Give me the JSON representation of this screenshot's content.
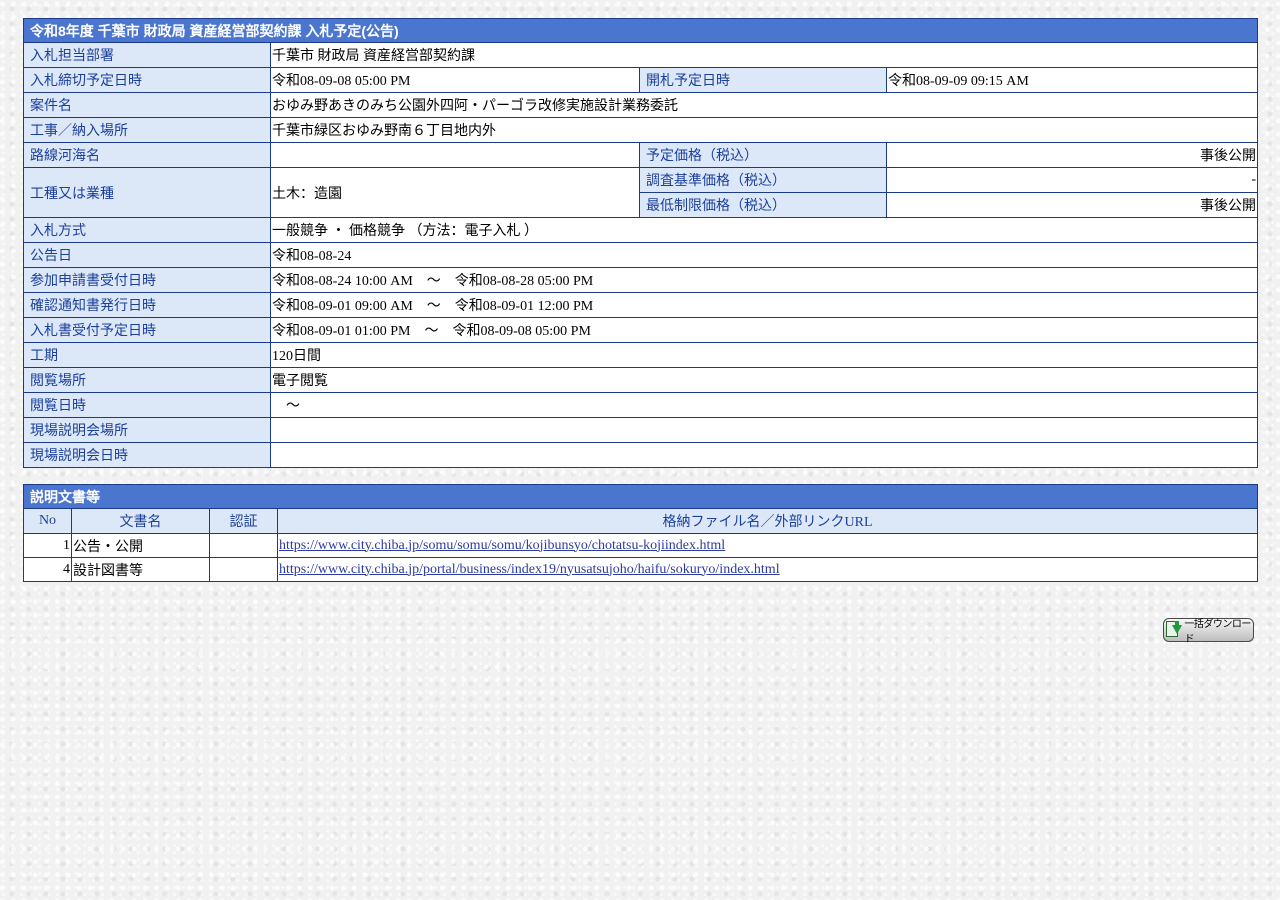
{
  "notice": {
    "title": "令和8年度 千葉市 財政局 資産経営部契約課 入札予定(公告)",
    "rows": {
      "department": {
        "label": "入札担当部署",
        "value": "千葉市 財政局 資産経営部契約課"
      },
      "deadline": {
        "label": "入札締切予定日時",
        "value": "令和08-09-08 05:00 PM"
      },
      "opening": {
        "label": "開札予定日時",
        "value": "令和08-09-09 09:15 AM"
      },
      "project_name": {
        "label": "案件名",
        "value": "おゆみ野あきのみち公園外四阿・パーゴラ改修実施設計業務委託"
      },
      "location": {
        "label": "工事／納入場所",
        "value": "千葉市緑区おゆみ野南６丁目地内外"
      },
      "route": {
        "label": "路線河海名",
        "value": ""
      },
      "planned_price": {
        "label": "予定価格（税込）",
        "value": "事後公開"
      },
      "work_type": {
        "label": "工種又は業種",
        "value": "土木：造園"
      },
      "survey_price": {
        "label": "調査基準価格（税込）",
        "value": "-"
      },
      "min_price": {
        "label": "最低制限価格（税込）",
        "value": "事後公開"
      },
      "bid_method": {
        "label": "入札方式",
        "value": "一般競争 ・ 価格競争 （方法：電子入札 ）"
      },
      "notice_date": {
        "label": "公告日",
        "value": "令和08-08-24"
      },
      "application_period": {
        "label": "参加申請書受付日時",
        "value": "令和08-08-24 10:00 AM　～　令和08-08-28 05:00 PM"
      },
      "confirmation_period": {
        "label": "確認通知書発行日時",
        "value": "令和08-09-01 09:00 AM　～　令和08-09-01 12:00 PM"
      },
      "bid_reception": {
        "label": "入札書受付予定日時",
        "value": "令和08-09-01 01:00 PM　～　令和08-09-08 05:00 PM"
      },
      "term": {
        "label": "工期",
        "value": "120日間"
      },
      "viewing_place": {
        "label": "閲覧場所",
        "value": "電子閲覧"
      },
      "viewing_date": {
        "label": "閲覧日時",
        "value": "　～"
      },
      "briefing_place": {
        "label": "現場説明会場所",
        "value": ""
      },
      "briefing_date": {
        "label": "現場説明会日時",
        "value": ""
      }
    }
  },
  "documents": {
    "title": "説明文書等",
    "headers": {
      "no": "No",
      "name": "文書名",
      "auth": "認証",
      "file": "格納ファイル名／外部リンクURL"
    },
    "items": [
      {
        "no": "1",
        "name": "公告・公開",
        "auth": "",
        "url": "https://www.city.chiba.jp/somu/somu/somu/kojibunsyo/chotatsu-kojiindex.html"
      },
      {
        "no": "4",
        "name": "設計図書等",
        "auth": "",
        "url": "https://www.city.chiba.jp/portal/business/index19/nyusatsujoho/haifu/sokuryo/index.html"
      }
    ]
  },
  "download_button": {
    "label": "一括ダウンロード",
    "icon": "download-icon"
  }
}
